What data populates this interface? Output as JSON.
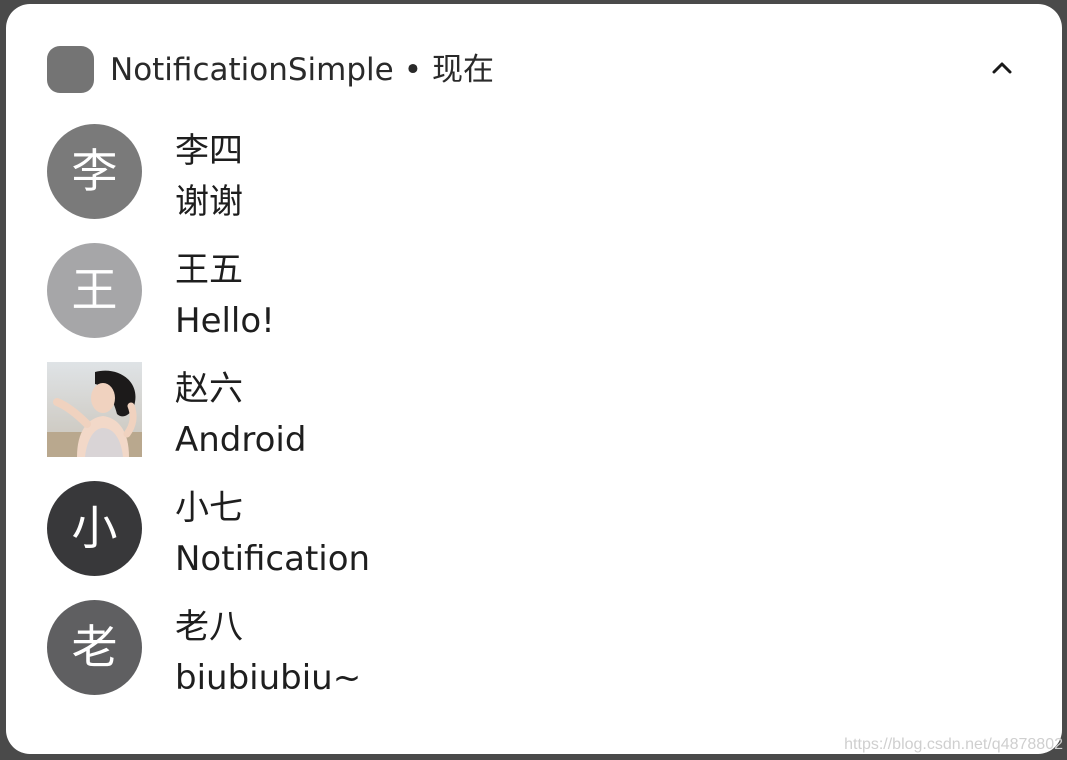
{
  "header": {
    "app_name": "NotificationSimple",
    "separator": "•",
    "time": "现在",
    "expand_icon": "chevron-up-icon"
  },
  "messages": [
    {
      "avatar_text": "李",
      "avatar_color": "#7a7a7a",
      "sender": "李四",
      "text": "谢谢"
    },
    {
      "avatar_text": "王",
      "avatar_color": "#a6a6a8",
      "sender": "王五",
      "text": "Hello!"
    },
    {
      "avatar_text": "",
      "avatar_type": "photo",
      "sender": "赵六",
      "text": "Android"
    },
    {
      "avatar_text": "小",
      "avatar_color": "#38383a",
      "sender": "小七",
      "text": "Notification"
    },
    {
      "avatar_text": "老",
      "avatar_color": "#5f5f61",
      "sender": "老八",
      "text": "biubiubiu~"
    }
  ],
  "watermark": "https://blog.csdn.net/q4878802"
}
